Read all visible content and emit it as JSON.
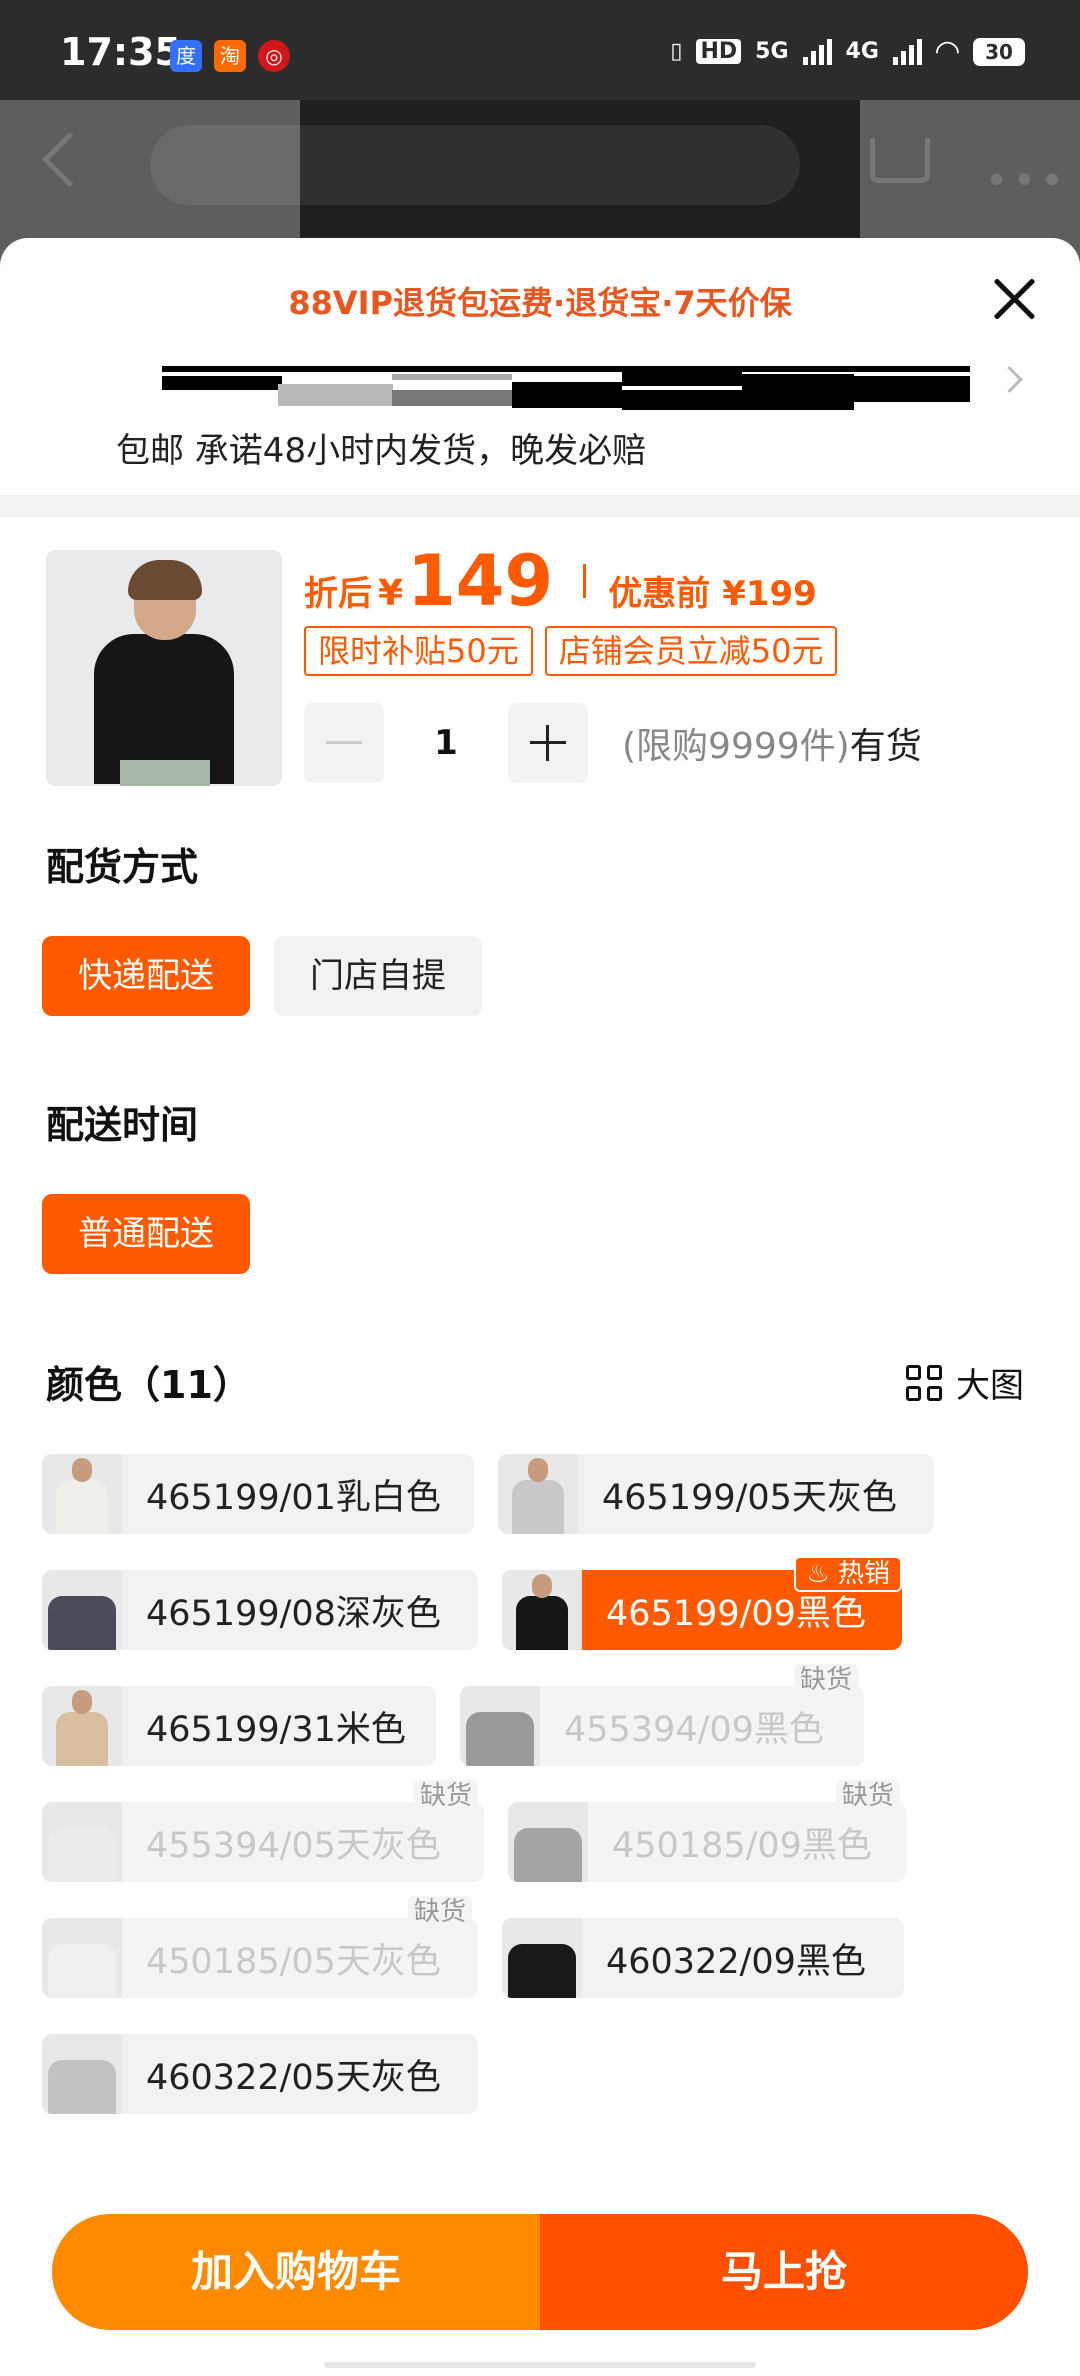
{
  "status_bar": {
    "time": "17:35",
    "app_icons": [
      {
        "name": "baidu-app-icon",
        "glyph": "度",
        "color": "#3370ff"
      },
      {
        "name": "taobao-app-icon",
        "glyph": "淘",
        "color": "#ff6a00"
      },
      {
        "name": "app-notify-icon",
        "glyph": "◎",
        "color": "#d0151b"
      }
    ],
    "hd_label": "HD",
    "net1": "5G",
    "net2": "4G",
    "battery": "30"
  },
  "sheet": {
    "promo_banner": "88VIP退货包运费·退货宝·7天价保",
    "shipping_note": "包邮 承诺48小时内发货，晚发必赔"
  },
  "product": {
    "price_prefix": "折后",
    "currency": "¥",
    "price": "149",
    "price_before_label": "优惠前",
    "price_before": "¥199",
    "tags": [
      "限时补贴50元",
      "店铺会员立减50元"
    ],
    "quantity": "1",
    "stock_limit": "(限购9999件)",
    "stock_status": "有货",
    "accent_color": "#ff5a00"
  },
  "delivery_method": {
    "title": "配货方式",
    "options": [
      {
        "label": "快递配送",
        "selected": true
      },
      {
        "label": "门店自提",
        "selected": false
      }
    ]
  },
  "delivery_time": {
    "title": "配送时间",
    "options": [
      {
        "label": "普通配送",
        "selected": true
      }
    ]
  },
  "colors": {
    "title": "颜色（11）",
    "big_picture_label": "大图",
    "sold_out_label": "缺货",
    "hot_label": "热销",
    "items": [
      {
        "label": "465199/01乳白色",
        "state": "normal",
        "swatch": "#f1efea"
      },
      {
        "label": "465199/05天灰色",
        "state": "normal",
        "swatch": "#c9c9cc"
      },
      {
        "label": "465199/08深灰色",
        "state": "normal",
        "swatch": "#4a4d57"
      },
      {
        "label": "465199/09黑色",
        "state": "selected",
        "swatch": "#161616"
      },
      {
        "label": "465199/31米色",
        "state": "normal",
        "swatch": "#d8bfa0"
      },
      {
        "label": "455394/09黑色",
        "state": "soldout",
        "swatch": "#9a9a9a"
      },
      {
        "label": "455394/05天灰色",
        "state": "soldout",
        "swatch": "#ebebeb"
      },
      {
        "label": "450185/09黑色",
        "state": "soldout",
        "swatch": "#a5a5a5"
      },
      {
        "label": "450185/05天灰色",
        "state": "soldout",
        "swatch": "#f0f0f0"
      },
      {
        "label": "460322/09黑色",
        "state": "normal",
        "swatch": "#1a1a1a"
      },
      {
        "label": "460322/05天灰色",
        "state": "normal",
        "swatch": "#c2c2c4"
      }
    ]
  },
  "actions": {
    "add_to_cart": "加入购物车",
    "buy_now": "马上抢"
  }
}
